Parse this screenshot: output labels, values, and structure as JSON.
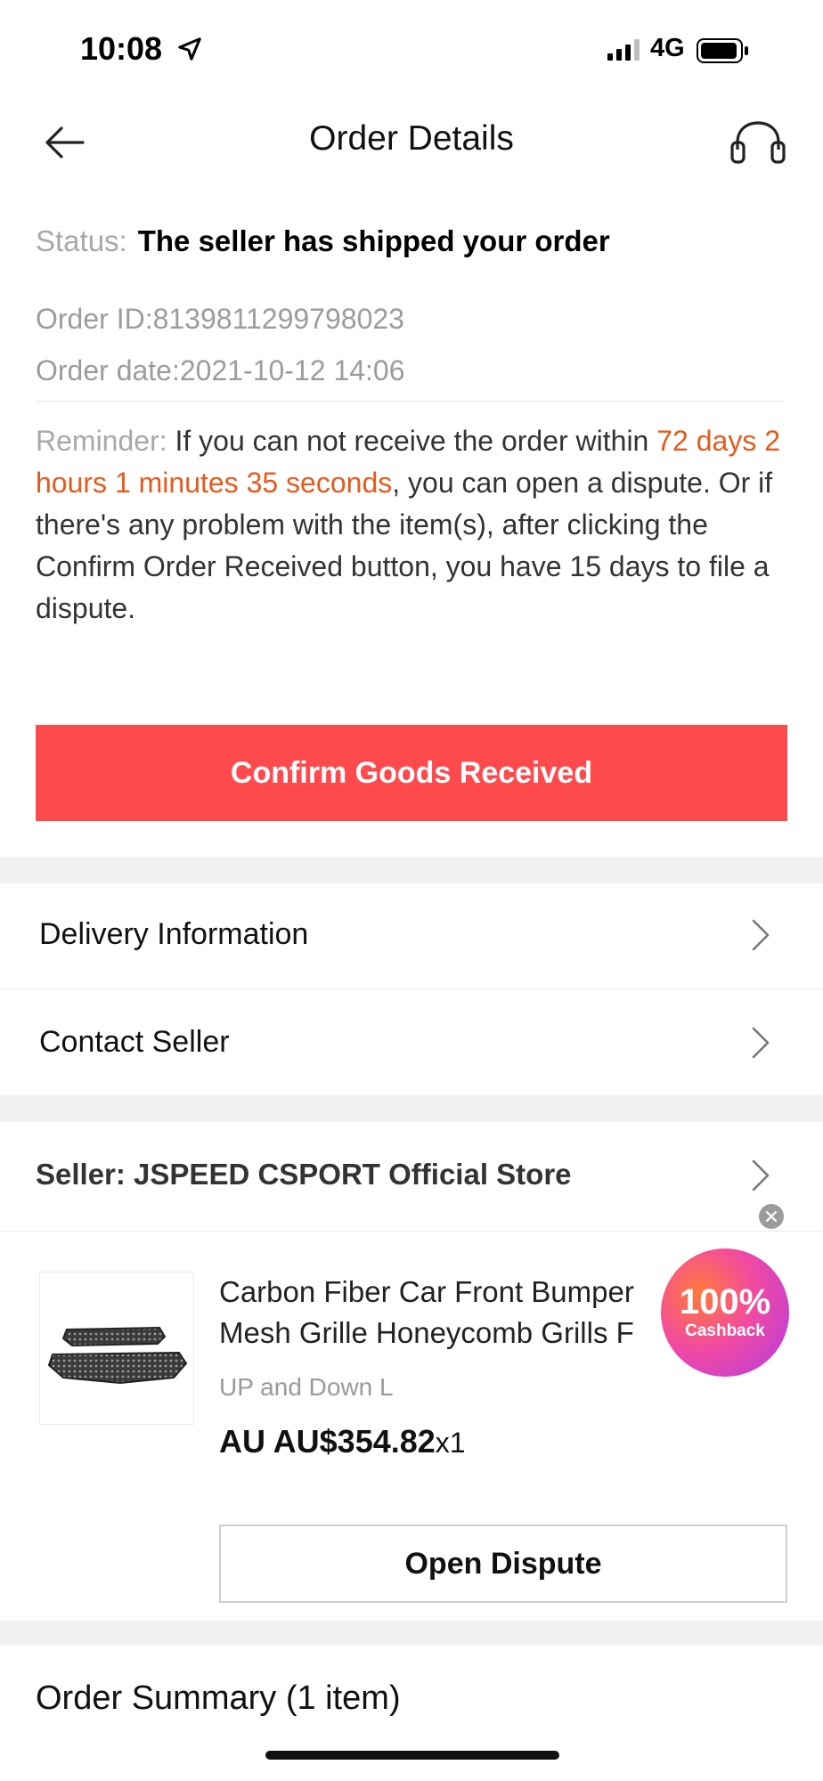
{
  "status_bar": {
    "time": "10:08",
    "network": "4G",
    "icons": [
      "location-arrow-icon",
      "signal-icon",
      "battery-icon"
    ]
  },
  "header": {
    "title": "Order Details",
    "icons": [
      "back-arrow-icon",
      "headset-icon"
    ]
  },
  "order": {
    "status_label": "Status:",
    "status_value": "The seller has shipped your order",
    "order_id": "Order ID:8139811299798023",
    "order_date": "Order date:2021-10-12 14:06"
  },
  "reminder": {
    "label": "Reminder:",
    "text_before": " If you can not receive the order within ",
    "countdown": "72 days 2 hours 1 minutes 35 seconds",
    "text_after": ", you can open a dispute. Or if there's any problem with the item(s), after clicking the Confirm Order Received button, you have 15 days to file a dispute."
  },
  "actions": {
    "confirm_label": "Confirm Goods Received"
  },
  "menu": {
    "delivery_label": "Delivery Information",
    "contact_label": "Contact Seller"
  },
  "seller": {
    "label": "Seller: JSPEED CSPORT Official Store"
  },
  "product": {
    "title_line1": "Carbon Fiber Car Front Bumper",
    "title_line2": "Mesh Grille Honeycomb Grills F",
    "sku": "UP and Down L",
    "price": "AU AU$354.82",
    "quantity": "x1",
    "dispute_label": "Open Dispute"
  },
  "cashback_badge": {
    "percent": "100%",
    "label": "Cashback"
  },
  "summary": {
    "title": "Order Summary (1 item)"
  },
  "colors": {
    "accent_red": "#ff4a4d",
    "countdown_orange": "#e55a1c",
    "muted_gray": "#a8a8a8",
    "section_gap": "#f1f1f1"
  }
}
